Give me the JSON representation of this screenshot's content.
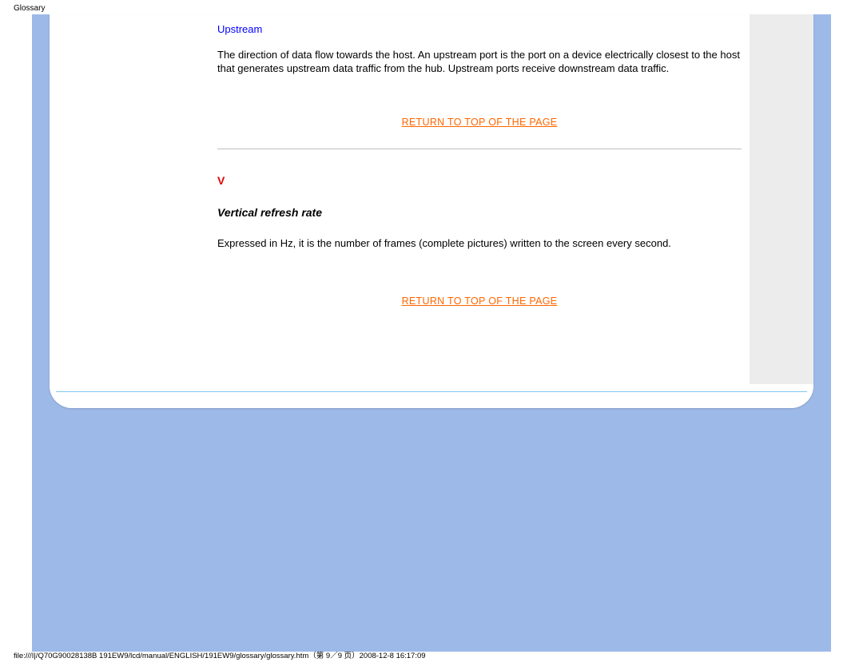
{
  "header": {
    "title": "Glossary"
  },
  "content": {
    "upstream_term": "Upstream",
    "upstream_def": "The direction of data flow towards the host. An upstream port is the port on a device electrically closest to the host that generates upstream data traffic from the hub. Upstream ports receive downstream data traffic.",
    "return_link_1": "RETURN TO TOP OF THE PAGE",
    "section_letter": "V",
    "vrr_term": "Vertical refresh rate",
    "vrr_def": "Expressed in Hz, it is the number of frames (complete pictures) written to the screen every second.",
    "return_link_2": "RETURN TO TOP OF THE PAGE"
  },
  "footer": {
    "path": "file:///I|/Q70G90028138B 191EW9/lcd/manual/ENGLISH/191EW9/glossary/glossary.htm（第 9／9 页）2008-12-8 16:17:09"
  }
}
